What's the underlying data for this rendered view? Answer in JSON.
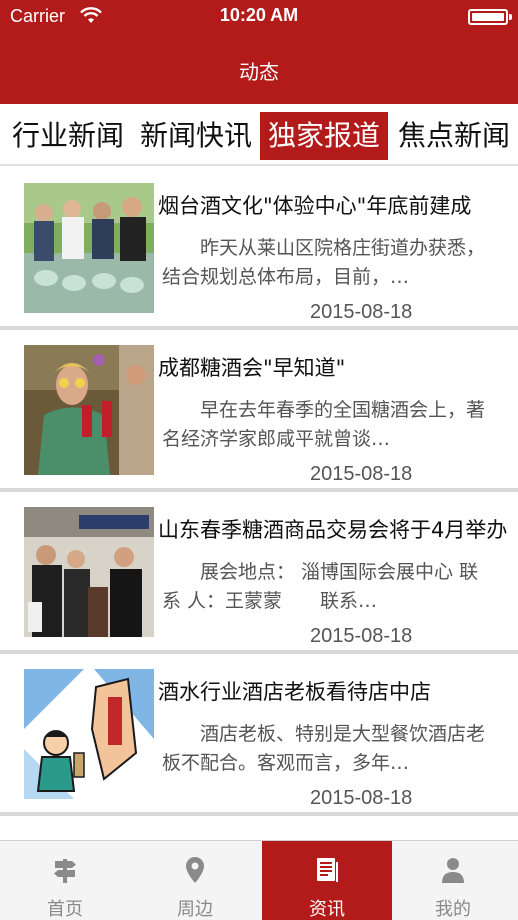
{
  "status_bar": {
    "carrier": "Carrier",
    "time": "10:20 AM"
  },
  "nav": {
    "title": "动态"
  },
  "tabs": [
    {
      "label": "行业新闻",
      "active": false
    },
    {
      "label": "新闻快讯",
      "active": false
    },
    {
      "label": "独家报道",
      "active": true
    },
    {
      "label": "焦点新闻",
      "active": false
    }
  ],
  "news": [
    {
      "title": "烟台酒文化\"体验中心\"年底前建成",
      "summary": "昨天从莱山区院格庄街道办获悉，结合规划总体布局，目前，…",
      "date": "2015-08-18"
    },
    {
      "title": "成都糖酒会\"早知道\"",
      "summary": "早在去年春季的全国糖酒会上，著名经济学家郎咸平就曾谈…",
      "date": "2015-08-18"
    },
    {
      "title": "山东春季糖酒商品交易会将于4月举办",
      "summary": "展会地点： 淄博国际会展中心 联 系 人：王蒙蒙　　联系…",
      "date": "2015-08-18"
    },
    {
      "title": "酒水行业酒店老板看待店中店",
      "summary": "酒店老板、特别是大型餐饮酒店老板不配合。客观而言，多年…",
      "date": "2015-08-18"
    }
  ],
  "tabbar": [
    {
      "label": "首页",
      "icon": "signpost-icon",
      "active": false
    },
    {
      "label": "周边",
      "icon": "location-pin-icon",
      "active": false
    },
    {
      "label": "资讯",
      "icon": "document-icon",
      "active": true
    },
    {
      "label": "我的",
      "icon": "person-icon",
      "active": false
    }
  ],
  "colors": {
    "brand": "#b31b1b",
    "divider": "#d9d9d9",
    "tabbar_bg": "#f4f4f4"
  }
}
